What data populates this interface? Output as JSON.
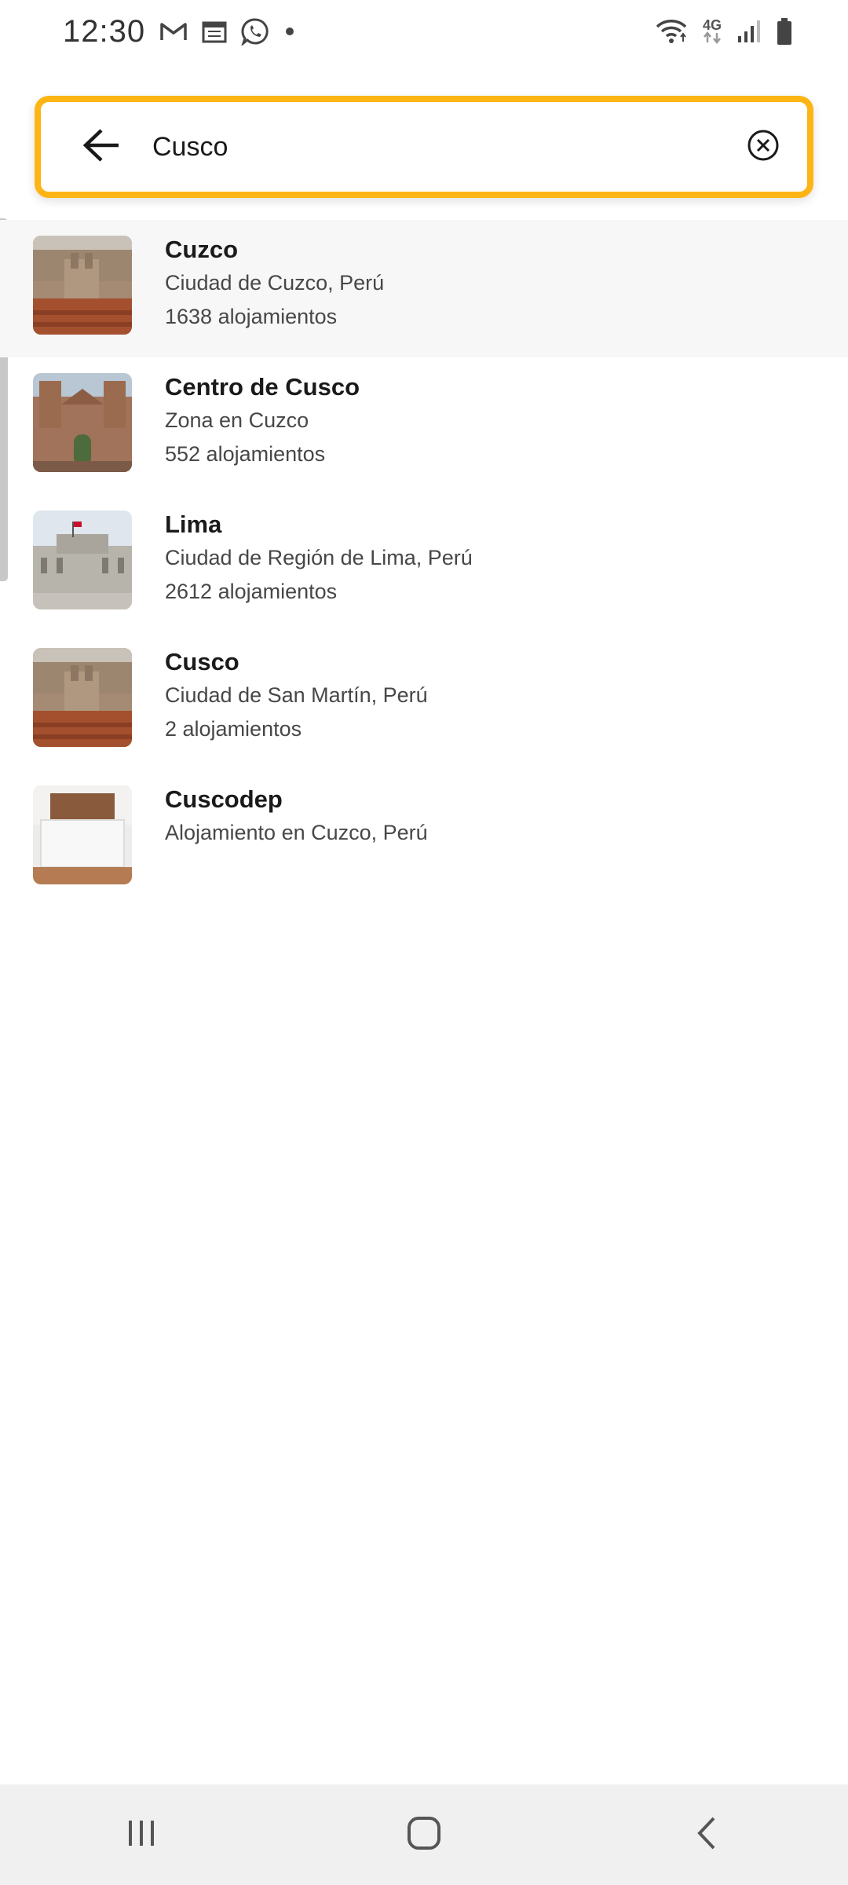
{
  "status_bar": {
    "time": "12:30",
    "network_label": "4G",
    "icons": [
      "gmail-icon",
      "calendar-icon",
      "whatsapp-icon",
      "notification-dot-icon",
      "wifi-icon",
      "mobile-data-icon",
      "signal-icon",
      "battery-icon"
    ]
  },
  "search": {
    "value": "Cusco",
    "back_icon": "arrow-left-icon",
    "clear_icon": "clear-circle-icon"
  },
  "results": [
    {
      "title": "Cuzco",
      "subtitle": "Ciudad de Cuzco, Perú",
      "count": "1638 alojamientos",
      "highlighted": true,
      "thumbnail": "city-aerial-image"
    },
    {
      "title": "Centro de Cusco",
      "subtitle": "Zona en Cuzco",
      "count": "552 alojamientos",
      "highlighted": false,
      "thumbnail": "cathedral-image"
    },
    {
      "title": "Lima",
      "subtitle": "Ciudad de Región de Lima, Perú",
      "count": "2612 alojamientos",
      "highlighted": false,
      "thumbnail": "palace-image"
    },
    {
      "title": "Cusco",
      "subtitle": "Ciudad de San Martín, Perú",
      "count": "2 alojamientos",
      "highlighted": false,
      "thumbnail": "city-aerial-image"
    },
    {
      "title": "Cuscodep",
      "subtitle": "Alojamiento en Cuzco, Perú",
      "count": "",
      "highlighted": false,
      "thumbnail": "bedroom-image"
    }
  ],
  "nav_bar": {
    "buttons": [
      "recent-apps-icon",
      "home-icon",
      "back-icon"
    ]
  },
  "colors": {
    "accent": "#fdb515",
    "highlight_row": "#f7f7f7",
    "nav_bar": "#f0f0f0"
  }
}
